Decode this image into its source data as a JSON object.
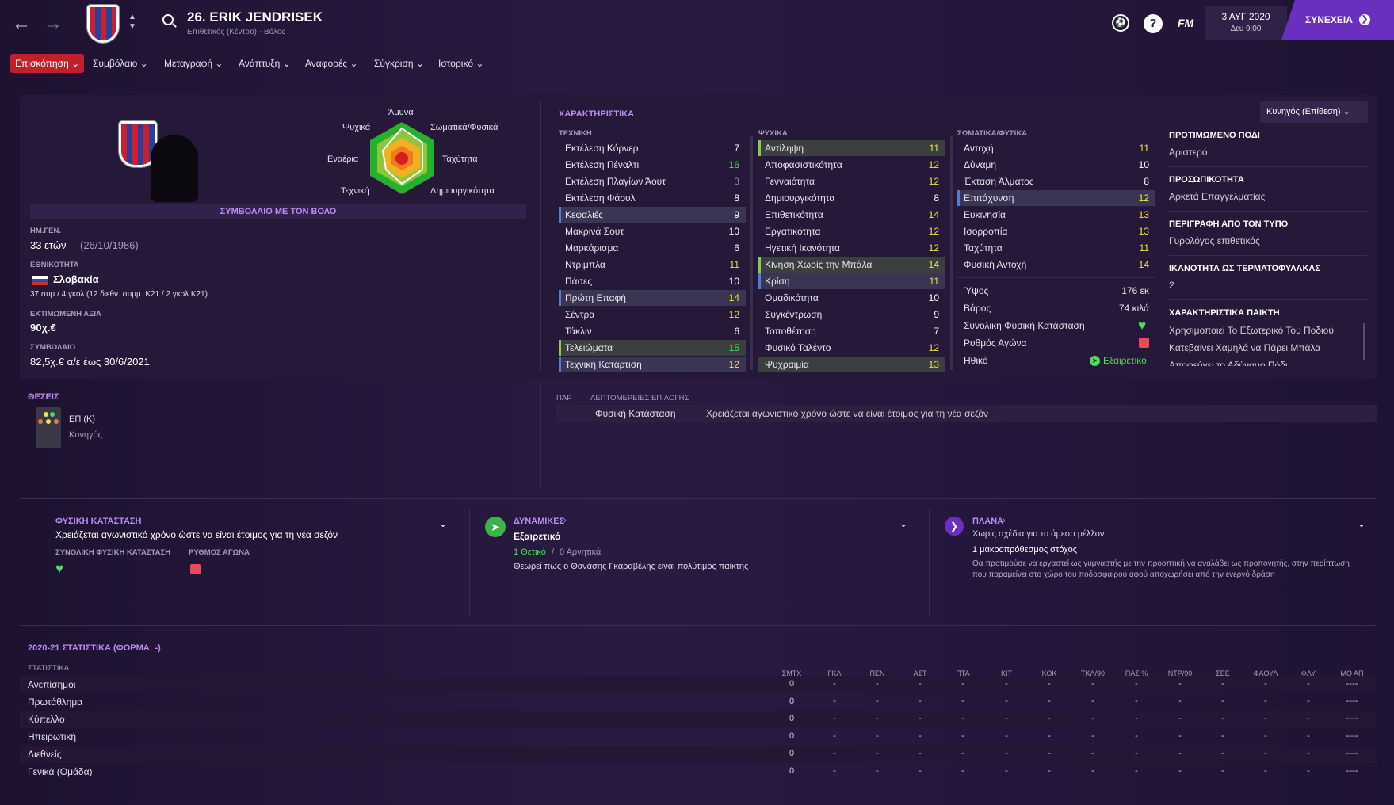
{
  "header": {
    "player_name": "26. ERIK JENDRISEK",
    "player_sub": "Επιθετικός (Κέντρο) - Βόλος",
    "date": "3 ΑΥΓ 2020",
    "day_time": "Δευ 9:00",
    "fm_label": "FM",
    "continue_label": "ΣΥΝΕΧΕΙΑ",
    "help_label": "?"
  },
  "menu": [
    "Επισκόπηση",
    "Συμβόλαιο",
    "Μεταγραφή",
    "Ανάπτυξη",
    "Αναφορές",
    "Σύγκριση",
    "Ιστορικό"
  ],
  "profile": {
    "contract_banner": "ΣΥΜΒΟΛΑΙΟ ΜΕ ΤΟΝ ΒΟΛΟ",
    "dob_label": "ΗΜ.ΓΕΝ.",
    "age": "33 ετών",
    "dob": "(26/10/1986)",
    "nationality_label": "ΕΘΝΙΚΟΤΗΤΑ",
    "nationality": "Σλοβακία",
    "caps": "37 συμ / 4 γκολ (12 διεθν. συμμ. Κ21 / 2 γκολ Κ21)",
    "value_label": "ΕΚΤΙΜΩΜΕΝΗ ΑΞΙΑ",
    "value": "90χ.€",
    "contract_label": "ΣΥΜΒΟΛΑΙΟ",
    "contract": "82,5χ.€ α/ε έως 30/6/2021"
  },
  "radar": {
    "labels": [
      "Άμυνα",
      "Σωματικά/Φυσικά",
      "Ταχύτητα",
      "Δημιουργικότητα",
      "Τεχνική",
      "Εναέρια",
      "Ψυχικά"
    ]
  },
  "attributes": {
    "title": "ΧΑΡΑΚΤΗΡΙΣΤΙΚΑ",
    "role_select": "Κυνηγός (Επίθεση)",
    "technical_label": "ΤΕΧΝΙΚΗ",
    "mental_label": "ΨΥΧΙΚΑ",
    "physical_label": "ΣΩΜΑΤΙΚΑ/ΦΥΣΙΚΑ",
    "technical": [
      {
        "n": "Εκτέλεση Κόρνερ",
        "v": "7"
      },
      {
        "n": "Εκτέλεση Πέναλτι",
        "v": "16"
      },
      {
        "n": "Εκτέλεση Πλαγίων Άουτ",
        "v": "3"
      },
      {
        "n": "Εκτέλεση Φάουλ",
        "v": "8"
      },
      {
        "n": "Κεφαλιές",
        "v": "9"
      },
      {
        "n": "Μακρινά Σουτ",
        "v": "10"
      },
      {
        "n": "Μαρκάρισμα",
        "v": "6"
      },
      {
        "n": "Ντρίμπλα",
        "v": "11"
      },
      {
        "n": "Πάσες",
        "v": "10"
      },
      {
        "n": "Πρώτη Επαφή",
        "v": "14"
      },
      {
        "n": "Σέντρα",
        "v": "12"
      },
      {
        "n": "Τάκλιν",
        "v": "6"
      },
      {
        "n": "Τελειώματα",
        "v": "15"
      },
      {
        "n": "Τεχνική Κατάρτιση",
        "v": "12"
      }
    ],
    "mental": [
      {
        "n": "Αντίληψη",
        "v": "11"
      },
      {
        "n": "Αποφασιστικότητα",
        "v": "12"
      },
      {
        "n": "Γενναιότητα",
        "v": "12"
      },
      {
        "n": "Δημιουργικότητα",
        "v": "8"
      },
      {
        "n": "Επιθετικότητα",
        "v": "14"
      },
      {
        "n": "Εργατικότητα",
        "v": "12"
      },
      {
        "n": "Ηγετική Ικανότητα",
        "v": "12"
      },
      {
        "n": "Κίνηση Χωρίς την Μπάλα",
        "v": "14"
      },
      {
        "n": "Κρίση",
        "v": "11"
      },
      {
        "n": "Ομαδικότητα",
        "v": "10"
      },
      {
        "n": "Συγκέντρωση",
        "v": "9"
      },
      {
        "n": "Τοποθέτηση",
        "v": "7"
      },
      {
        "n": "Φυσικό Ταλέντο",
        "v": "12"
      },
      {
        "n": "Ψυχραιμία",
        "v": "13"
      }
    ],
    "physical": [
      {
        "n": "Αντοχή",
        "v": "11"
      },
      {
        "n": "Δύναμη",
        "v": "10"
      },
      {
        "n": "Έκταση Άλματος",
        "v": "8"
      },
      {
        "n": "Επιτάχυνση",
        "v": "12"
      },
      {
        "n": "Ευκινησία",
        "v": "13"
      },
      {
        "n": "Ισορροπία",
        "v": "13"
      },
      {
        "n": "Ταχύτητα",
        "v": "11"
      },
      {
        "n": "Φυσική Αντοχή",
        "v": "14"
      }
    ],
    "height_label": "Ύψος",
    "height": "176 εκ",
    "weight_label": "Βάρος",
    "weight": "74 κιλά",
    "fitness_label": "Συνολική Φυσική Κατάσταση",
    "match_label": "Ρυθμός Αγώνα",
    "morale_label": "Ηθικό",
    "morale": "Εξαιρετικό"
  },
  "right_panel": {
    "foot_label": "ΠΡΟΤΙΜΩΜΕΝΟ ΠΟΔΙ",
    "foot": "Αριστερό",
    "personality_label": "ΠΡΟΣΩΠΙΚΟΤΗΤΑ",
    "personality": "Αρκετά Επαγγελματίας",
    "press_label": "ΠΕΡΙΓΡΑΦΗ ΑΠΟ ΤΟΝ ΤΥΠΟ",
    "press": "Γυρολόγος επιθετικός",
    "gk_label": "ΙΚΑΝΟΤΗΤΑ ΩΣ ΤΕΡΜΑΤΟΦΥΛΑΚΑΣ",
    "gk": "2",
    "traits_label": "ΧΑΡΑΚΤΗΡΙΣΤΙΚΑ ΠΑΙΚΤΗ",
    "traits": [
      "Χρησιμοποιεί Το Εξωτερικό Του Ποδιού",
      "Κατεβαίνει Χαμηλά να Πάρει Μπάλα",
      "Αποφεύγει το Αδύναμο Πόδι"
    ]
  },
  "positions": {
    "title": "ΘΕΣΕΙΣ",
    "pos": "ΕΠ (Κ)",
    "role": "Κυνηγός"
  },
  "selection": {
    "col1": "ΠΑΡ",
    "col2": "ΛΕΠΤΟΜΕΡΕΙΕΣ ΕΠΙΛΟΓΗΣ",
    "reason": "Φυσική Κατάσταση",
    "detail": "Χρειάζεται αγωνιστικό χρόνο ώστε να είναι έτοιμος για τη νέα σεζόν"
  },
  "fitness_card": {
    "title": "ΦΥΣΙΚΗ ΚΑΤΑΣΤΑΣΗ",
    "text": "Χρειάζεται αγωνιστικό χρόνο ώστε να είναι έτοιμος για τη νέα σεζόν",
    "overall_label": "ΣΥΝΟΛΙΚΗ ΦΥΣΙΚΗ ΚΑΤΑΣΤΑΣΗ",
    "match_label": "ΡΥΘΜΟΣ ΑΓΩΝΑ"
  },
  "dynamics_card": {
    "title": "ΔΥΝΑΜΙΚΕΣ",
    "value": "Εξαιρετικό",
    "positive": "1 Θετικό",
    "sep": "/",
    "negative": "0 Αρνητικά",
    "text": "Θεωρεί πως ο Θανάσης Γκαραβέλης είναι πολύτιμος παίκτης"
  },
  "plans_card": {
    "title": "ΠΛΑΝΑ",
    "subtitle": "Χωρίς σχέδια για το άμεσο μέλλον",
    "goal": "1 μακροπρόθεσμος στόχος",
    "text1": "Θα προτιμούσε να εργαστεί ως γυμναστής με την προοπτική να αναλάβει ως προπονητής, στην περίπτωση",
    "text2": "που παραμείνει στο χώρο του ποδοσφαίρου αφού αποχωρήσει από την ενεργό δράση"
  },
  "stats": {
    "title": "2020-21 ΣΤΑΤΙΣΤΙΚΑ (ΦΟΡΜΑ: -)",
    "row_label": "ΣΤΑΤΙΣΤΙΚΑ",
    "columns": [
      "ΣΜΤΧ",
      "ΓΚΛ",
      "ΠΕΝ",
      "ΑΣΤ",
      "ΠΤΑ",
      "ΚΙΤ",
      "ΚΟΚ",
      "ΤΚΛ/90",
      "ΠΑΣ %",
      "ΝΤΡ/90",
      "ΣΕΕ",
      "ΦΑΟΥΛ",
      "ΦΛΥ",
      "ΜΟ ΑΠ"
    ],
    "rows": [
      {
        "name": "Ανεπίσημοι",
        "vals": [
          "0",
          "-",
          "-",
          "-",
          "-",
          "-",
          "-",
          "-",
          "-",
          "-",
          "-",
          "-",
          "-",
          "----"
        ]
      },
      {
        "name": "Πρωτάθλημα",
        "vals": [
          "0",
          "-",
          "-",
          "-",
          "-",
          "-",
          "-",
          "-",
          "-",
          "-",
          "-",
          "-",
          "-",
          "----"
        ]
      },
      {
        "name": "Κύπελλο",
        "vals": [
          "0",
          "-",
          "-",
          "-",
          "-",
          "-",
          "-",
          "-",
          "-",
          "-",
          "-",
          "-",
          "-",
          "----"
        ]
      },
      {
        "name": "Ηπειρωτική",
        "vals": [
          "0",
          "-",
          "-",
          "-",
          "-",
          "-",
          "-",
          "-",
          "-",
          "-",
          "-",
          "-",
          "-",
          "----"
        ]
      },
      {
        "name": "Διεθνείς",
        "vals": [
          "0",
          "-",
          "-",
          "-",
          "-",
          "-",
          "-",
          "-",
          "-",
          "-",
          "-",
          "-",
          "-",
          "----"
        ]
      },
      {
        "name": "Γενικά (Ομάδα)",
        "vals": [
          "0",
          "-",
          "-",
          "-",
          "-",
          "-",
          "-",
          "-",
          "-",
          "-",
          "-",
          "-",
          "-",
          "----"
        ]
      }
    ]
  },
  "colors": {
    "accent": "#6b2fc0",
    "menu_active": "#c0202a",
    "attr_high": "#4fdc5a",
    "attr_mid": "#f2e34b",
    "section_title": "#b88cf0"
  }
}
